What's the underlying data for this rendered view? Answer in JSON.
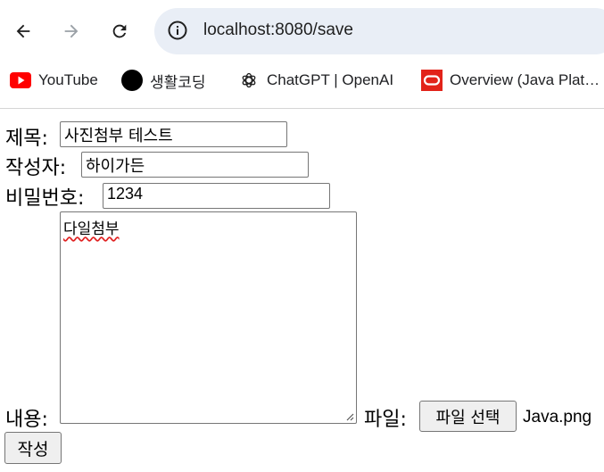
{
  "browser": {
    "url": "localhost:8080/save",
    "bookmarks": [
      {
        "label": "YouTube",
        "icon": "youtube-icon"
      },
      {
        "label": "생활코딩",
        "icon": "black-circle-icon"
      },
      {
        "label": "ChatGPT | OpenAI",
        "icon": "openai-icon"
      },
      {
        "label": "Overview (Java Plat…",
        "icon": "oracle-icon"
      }
    ]
  },
  "form": {
    "title_label": "제목:",
    "title_value": "사진첨부 테스트",
    "writer_label": "작성자:",
    "writer_value": "하이가든",
    "password_label": "비밀번호:",
    "password_value": "1234",
    "content_label": "내용:",
    "content_value": "다일첨부",
    "file_label": "파일:",
    "file_button": "파일 선택",
    "file_name": "Java.png",
    "submit_label": "작성"
  },
  "colors": {
    "omnibox_bg": "#e9eef6",
    "youtube_red": "#ff0000",
    "oracle_red": "#e2231a",
    "spellcheck_underline": "#e02020"
  }
}
